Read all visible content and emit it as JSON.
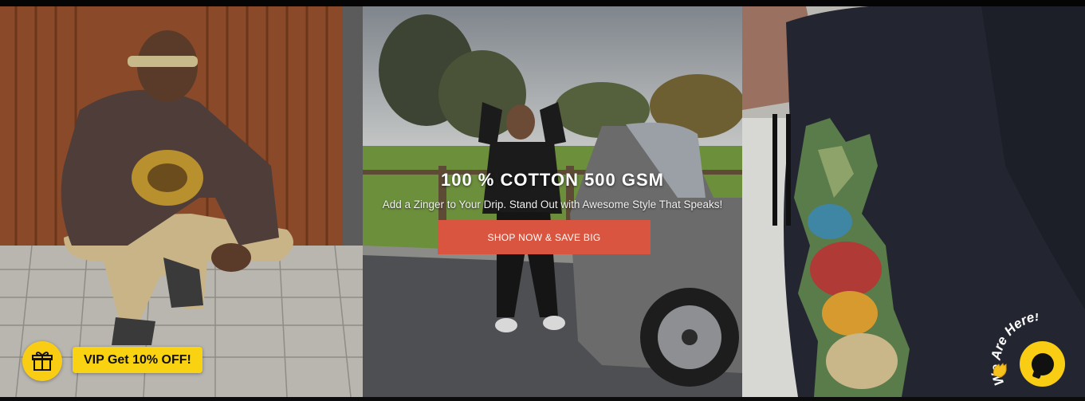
{
  "hero": {
    "headline": "100 % COTTON 500 GSM",
    "subline": "Add a Zinger to Your Drip. Stand Out with Awesome Style That Speaks!",
    "cta_label": "SHOP NOW & SAVE BIG",
    "panels": [
      {
        "subject": "man in brown hoodie crouching by wooden wall"
      },
      {
        "subject": "man in black hoodie beside open car trunk in park"
      },
      {
        "subject": "close-up of hoodie sleeve with dragon print"
      }
    ]
  },
  "promo": {
    "icon": "gift-icon",
    "label": "VIP Get 10% OFF!"
  },
  "chat": {
    "icon": "chat-bubble-icon",
    "label": "We Are Here!"
  },
  "colors": {
    "accent": "#d9553f",
    "promo_yellow": "#f9d312",
    "background": "#0c0c0c"
  }
}
